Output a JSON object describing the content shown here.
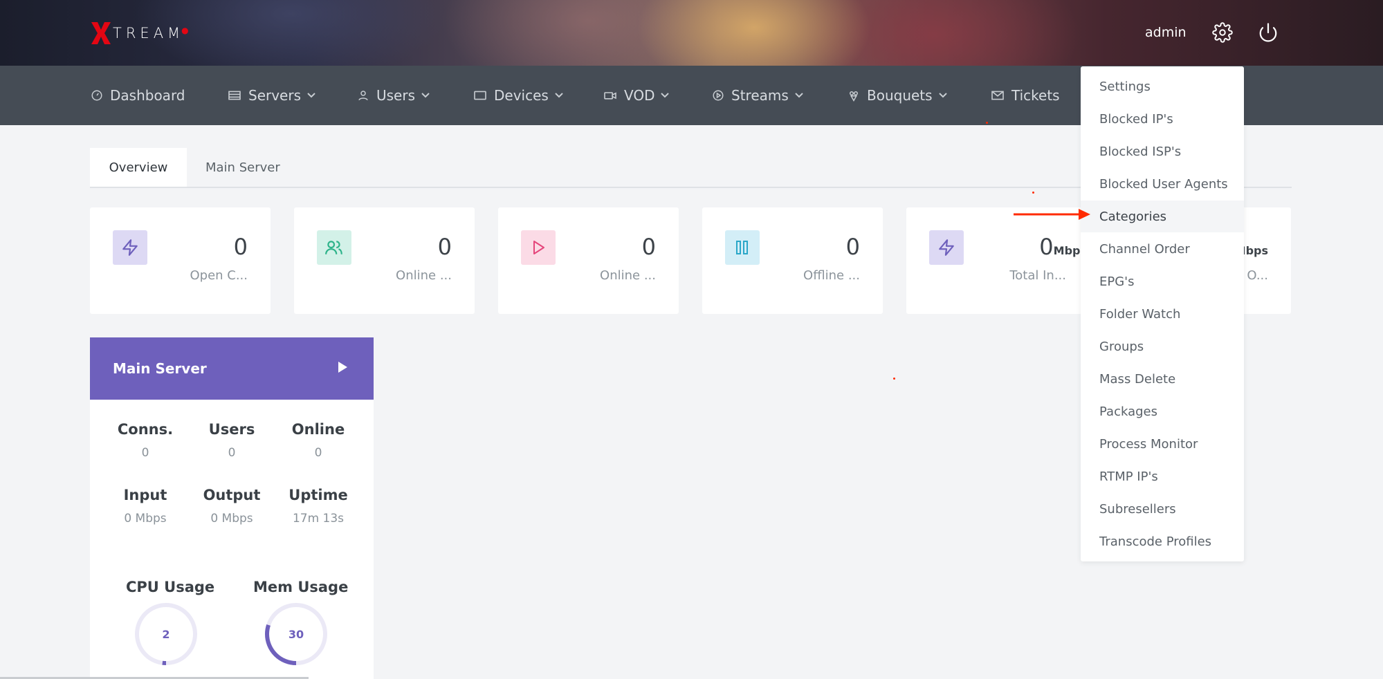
{
  "header": {
    "logo_text": "TREAM",
    "user": "admin",
    "icons": [
      "gear-icon",
      "power-icon"
    ]
  },
  "nav": {
    "items": [
      {
        "label": "Dashboard",
        "icon": "dashboard-icon"
      },
      {
        "label": "Servers",
        "icon": "servers-icon"
      },
      {
        "label": "Users",
        "icon": "user-icon"
      },
      {
        "label": "Devices",
        "icon": "devices-icon"
      },
      {
        "label": "VOD",
        "icon": "video-icon"
      },
      {
        "label": "Streams",
        "icon": "play-circle-icon"
      },
      {
        "label": "Bouquets",
        "icon": "bouquet-icon"
      },
      {
        "label": "Tickets",
        "icon": "mail-icon"
      }
    ]
  },
  "tabs": [
    "Overview",
    "Main Server"
  ],
  "cards": [
    {
      "value": "0",
      "unit": "",
      "label": "Open C...",
      "icon": "bolt-icon"
    },
    {
      "value": "0",
      "unit": "",
      "label": "Online ...",
      "icon": "users-icon"
    },
    {
      "value": "0",
      "unit": "",
      "label": "Online ...",
      "icon": "play-icon"
    },
    {
      "value": "0",
      "unit": "",
      "label": "Offline ...",
      "icon": "pause-icon"
    },
    {
      "value": "0",
      "unit": "Mbps",
      "label": "Total In...",
      "icon": "bolt-icon"
    },
    {
      "value": "",
      "unit": "Mbps",
      "label": "O..."
    }
  ],
  "server": {
    "title": "Main Server",
    "stats": [
      {
        "label": "Conns.",
        "value": "0"
      },
      {
        "label": "Users",
        "value": "0"
      },
      {
        "label": "Online",
        "value": "0"
      },
      {
        "label": "Input",
        "value": "0 Mbps"
      },
      {
        "label": "Output",
        "value": "0 Mbps"
      },
      {
        "label": "Uptime",
        "value": "17m 13s"
      }
    ],
    "cpu": {
      "label": "CPU Usage",
      "value": "2",
      "percent": 2
    },
    "mem": {
      "label": "Mem Usage",
      "value": "30",
      "percent": 30
    }
  },
  "dropdown": {
    "items": [
      "Settings",
      "Blocked IP's",
      "Blocked ISP's",
      "Blocked User Agents",
      "Categories",
      "Channel Order",
      "EPG's",
      "Folder Watch",
      "Groups",
      "Mass Delete",
      "Packages",
      "Process Monitor",
      "RTMP IP's",
      "Subresellers",
      "Transcode Profiles"
    ],
    "highlighted": "Categories"
  },
  "colors": {
    "accent": "#6e60bc",
    "nav_bg": "#454c55",
    "arrow": "#ff2a00"
  }
}
